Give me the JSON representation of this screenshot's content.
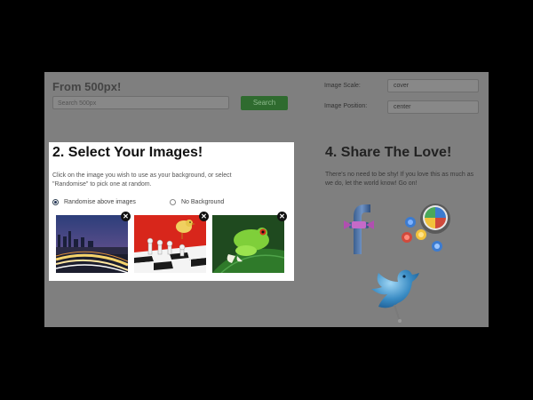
{
  "source": {
    "title": "From 500px!",
    "search_placeholder": "Search 500px",
    "search_button": "Search"
  },
  "options": {
    "scale_label": "Image Scale:",
    "scale_value": "cover",
    "position_label": "Image Position:",
    "position_value": "center"
  },
  "select": {
    "title": "2. Select Your Images!",
    "description": "Click on the image you wish to use as your background, or select \"Randomise\" to pick one at random.",
    "radio_randomise": "Randomise above images",
    "radio_none": "No Background",
    "selected": "randomise",
    "images": [
      {
        "subject": "city-night-skyline"
      },
      {
        "subject": "chess-board-with-bird"
      },
      {
        "subject": "green-frog-on-leaf"
      }
    ],
    "remove_glyph": "✕"
  },
  "share": {
    "title": "4. Share The Love!",
    "text": "There's no need to be shy! If you love this as much as we do, let the world know! Go on!",
    "icons": [
      "facebook-icon",
      "google-plus-icon",
      "twitter-bird-icon"
    ]
  },
  "colors": {
    "search_button": "#2f6b2f",
    "overlay": "#7f7f7f"
  }
}
